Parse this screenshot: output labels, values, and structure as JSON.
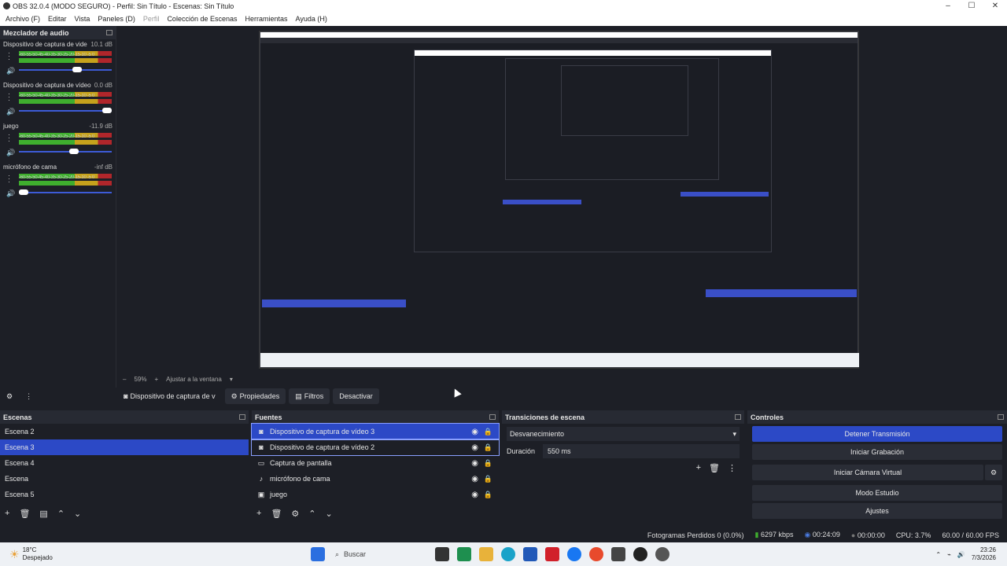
{
  "window": {
    "title": "OBS 32.0.4 (MODO SEGURO) - Perfil: Sin Título - Escenas: Sin Título",
    "min": "–",
    "max": "☐",
    "close": "✕"
  },
  "menu": [
    "Archivo (F)",
    "Editar",
    "Vista",
    "Paneles (D)",
    "Perfil",
    "Colección de Escenas",
    "Herramientas",
    "Ayuda (H)"
  ],
  "mixer": {
    "title": "Mezclador de audio",
    "ticks": "-60-55-50-45-40-35-30-25-20-15-10 -5 0",
    "channels": [
      {
        "name": "Dispositivo de captura de vide",
        "db": "10.1 dB",
        "level": 0.55
      },
      {
        "name": "Dispositivo de captura de vídeo",
        "db": "0.0 dB",
        "level": 1.0
      },
      {
        "name": "juego",
        "db": "-11.9 dB",
        "level": 0.6
      },
      {
        "name": "micrófono de cama",
        "db": "-inf dB",
        "level": 0.05
      }
    ]
  },
  "zoom": {
    "minus": "–",
    "value": "59%",
    "plus": "+",
    "fit": "Ajustar a la ventana"
  },
  "source_toolbar": {
    "current": "Dispositivo de captura de v",
    "properties": "Propiedades",
    "filters": "Filtros",
    "deactivate": "Desactivar"
  },
  "scenes": {
    "title": "Escenas",
    "items": [
      "Escena 2",
      "Escena 3",
      "Escena 4",
      "Escena",
      "Escena 5"
    ],
    "selected": 1
  },
  "sources": {
    "title": "Fuentes",
    "items": [
      {
        "name": "Dispositivo de captura de vídeo 3",
        "icon": "camera-icon"
      },
      {
        "name": "Dispositivo de captura de vídeo 2",
        "icon": "camera-icon"
      },
      {
        "name": "Captura de pantalla",
        "icon": "monitor-icon"
      },
      {
        "name": "micrófono de cama",
        "icon": "microphone-icon"
      },
      {
        "name": "juego",
        "icon": "gamepad-icon"
      }
    ]
  },
  "transitions": {
    "title": "Transiciones de escena",
    "selected": "Desvanecimiento",
    "duration_label": "Duración",
    "duration": "550 ms"
  },
  "controls": {
    "title": "Controles",
    "stop_stream": "Detener Transmisión",
    "start_rec": "Iniciar Grabación",
    "virtual_cam": "Iniciar Cámara Virtual",
    "studio": "Modo Estudio",
    "settings": "Ajustes"
  },
  "status": {
    "dropped": "Fotogramas Perdidos 0 (0.0%)",
    "bitrate": "6297 kbps",
    "stream_time": "00:24:09",
    "rec_time": "00:00:00",
    "cpu": "CPU: 3.7%",
    "fps": "60.00 / 60.00 FPS"
  },
  "taskbar": {
    "temp": "18°C",
    "weather": "Despejado",
    "search": "Buscar",
    "time": "23:26",
    "date": "7/3/2026"
  },
  "colors": {
    "accent": "#2c49c6",
    "bg": "#1d1f26",
    "panel": "#272a33"
  }
}
